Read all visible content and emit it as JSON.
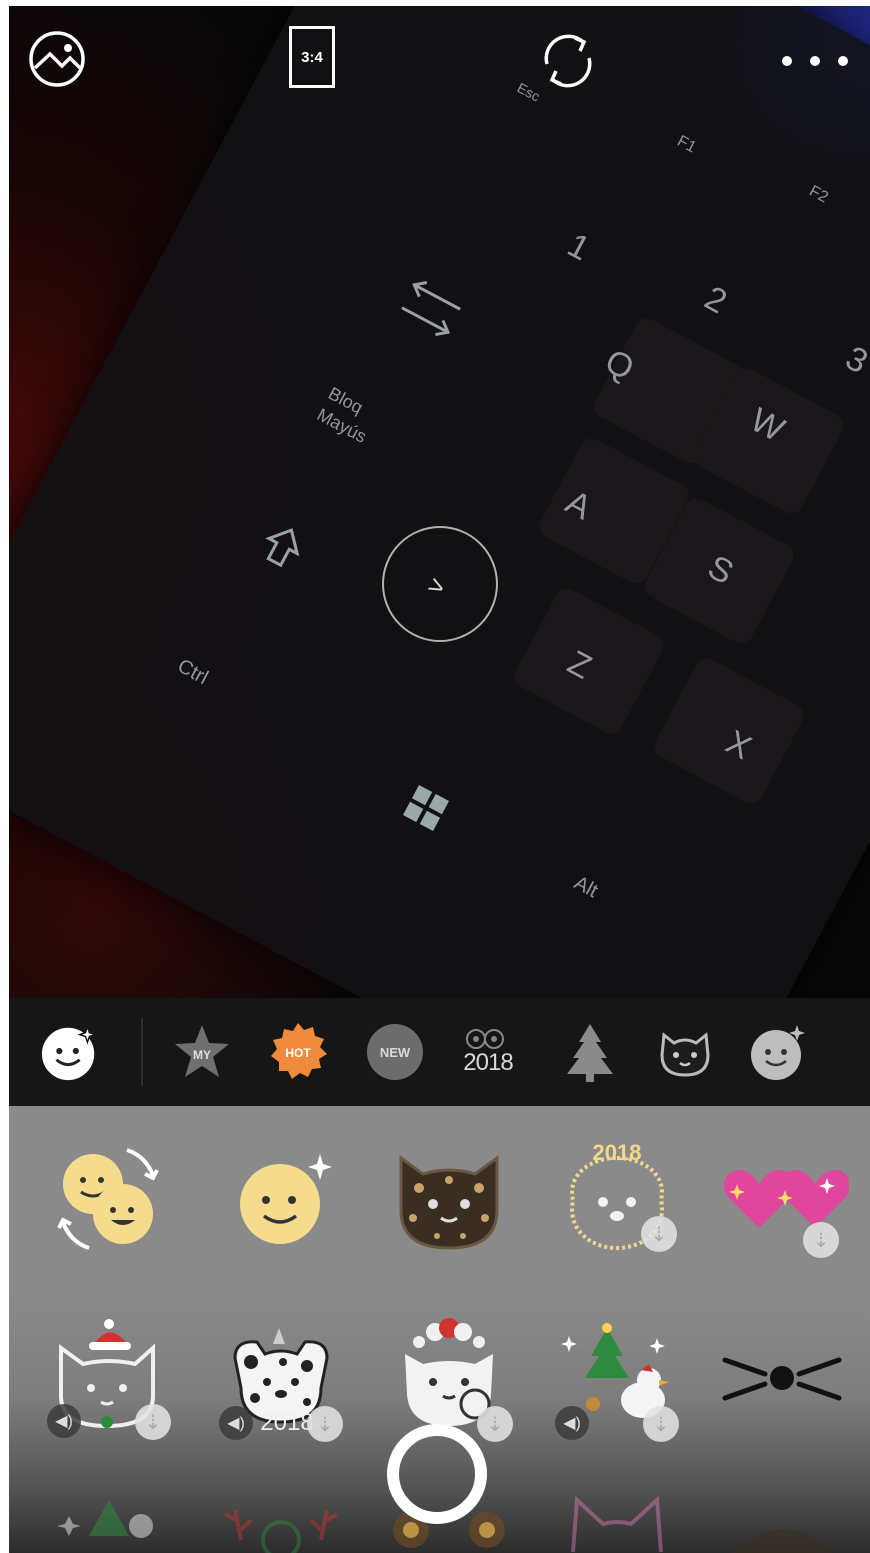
{
  "top_bar": {
    "ratio_label": "3:4",
    "icons": [
      "gallery-icon",
      "aspect-ratio-button",
      "switch-camera-icon",
      "more-options-icon"
    ]
  },
  "preview": {
    "visible_key_labels": [
      "Esc",
      "F1",
      "F2",
      "1",
      "2",
      "3",
      "Q",
      "W",
      "A",
      "S",
      "Z",
      "X",
      "Bloq\nMayús",
      "Ctrl",
      "Alt"
    ]
  },
  "category_bar": {
    "items": [
      {
        "icon": "current-effect-face-icon",
        "label": ""
      },
      {
        "icon": "star-icon",
        "label": "MY"
      },
      {
        "icon": "hot-badge-icon",
        "label": "HOT",
        "color": "#f08a3c"
      },
      {
        "icon": "new-badge-icon",
        "label": "NEW"
      },
      {
        "icon": "year-2018-icon",
        "label": "2018"
      },
      {
        "icon": "christmas-tree-icon",
        "label": ""
      },
      {
        "icon": "tiger-face-icon",
        "label": ""
      },
      {
        "icon": "sparkle-face-icon",
        "label": ""
      }
    ]
  },
  "stickers": {
    "row1": [
      {
        "icon": "swap-faces-icon"
      },
      {
        "icon": "sparkle-face-icon"
      },
      {
        "icon": "leopard-cat-icon"
      },
      {
        "icon": "dog-2018-icon",
        "label": "2018",
        "download": true
      },
      {
        "icon": "pink-hearts-icon",
        "download": true
      }
    ],
    "row2": [
      {
        "icon": "santa-cat-icon",
        "sound": true,
        "download": true
      },
      {
        "icon": "dalmatian-2018-icon",
        "label": "2018",
        "sound": true,
        "download": true
      },
      {
        "icon": "white-cat-flowers-icon",
        "download": true
      },
      {
        "icon": "christmas-bird-icon",
        "sound": true,
        "download": true
      },
      {
        "icon": "whiskers-icon"
      }
    ]
  },
  "colors": {
    "hot_badge": "#f08a3c",
    "grid_background": "#8a8a8a",
    "category_bar": "#161616"
  }
}
